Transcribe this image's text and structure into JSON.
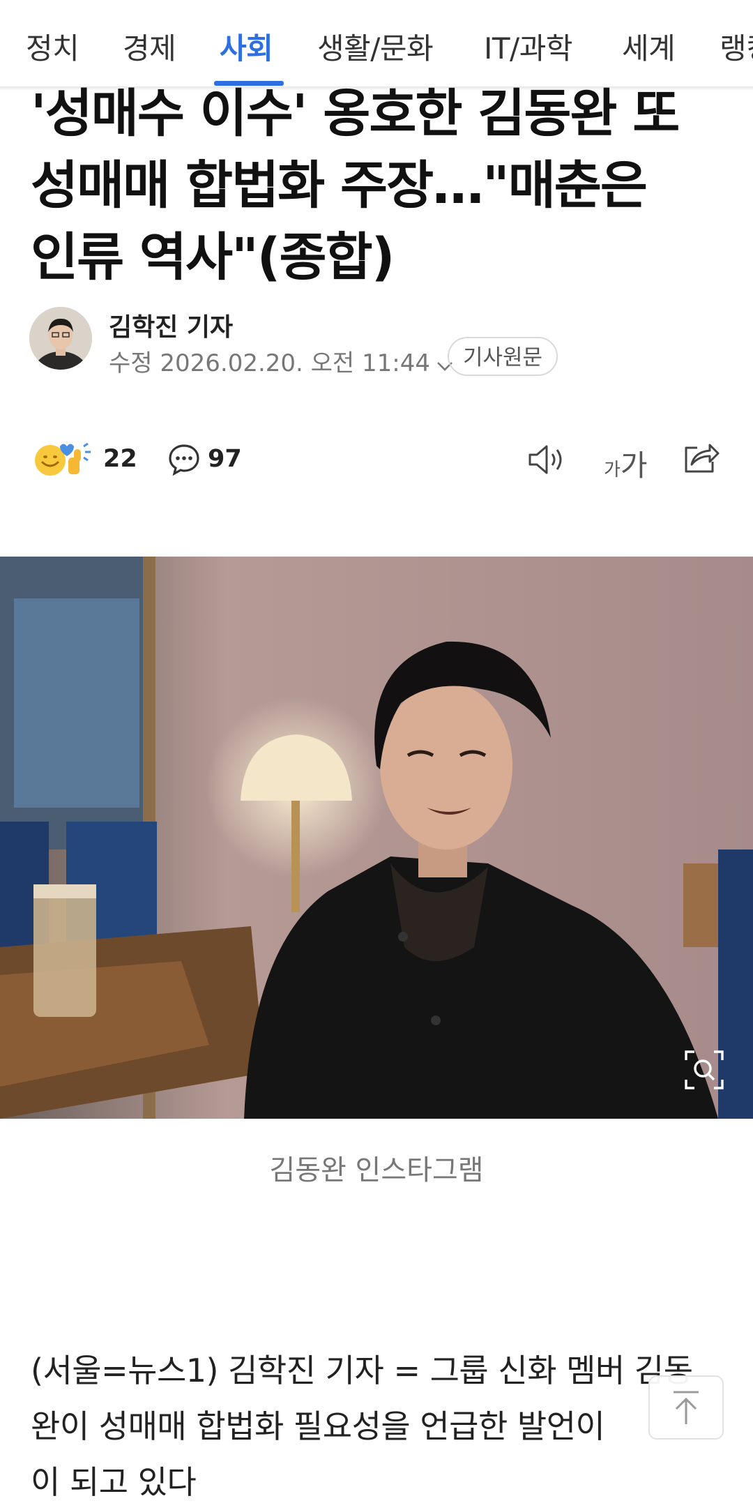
{
  "tabs": [
    {
      "label": "정치",
      "active": false
    },
    {
      "label": "경제",
      "active": false
    },
    {
      "label": "사회",
      "active": true
    },
    {
      "label": "생활/문화",
      "active": false
    },
    {
      "label": "IT/과학",
      "active": false
    },
    {
      "label": "세계",
      "active": false
    },
    {
      "label": "랭킹",
      "active": false
    }
  ],
  "accent_color": "#2d6fe3",
  "article": {
    "headline_lines": [
      "'성매수 이수' 옹호한 김동완 또",
      "성매매 합법화 주장…\"매춘은",
      "인류 역사\"(종합)"
    ],
    "author": "김학진 기자",
    "modified": "수정 2026.02.20. 오전 11:44",
    "original_button": "기사원문",
    "reactions_count": "22",
    "comments_count": "97",
    "font_small": "가",
    "font_big": "가",
    "photo_caption": "김동완 인스타그램",
    "body_lines": [
      "(서울=뉴스1) 김학진 기자 = 그룹 신화 멤버 김동",
      "완이 성매매 합법화 필요성을 언급한 발언이",
      "이 되고 있다"
    ]
  },
  "icons": {
    "reaction": "emoji-reaction-icon",
    "comment": "speech-bubble-icon",
    "tts": "speaker-icon",
    "share": "share-icon",
    "zoom": "zoom-search-icon",
    "scroll_top": "arrow-up-icon",
    "chevron": "chevron-down-icon"
  }
}
